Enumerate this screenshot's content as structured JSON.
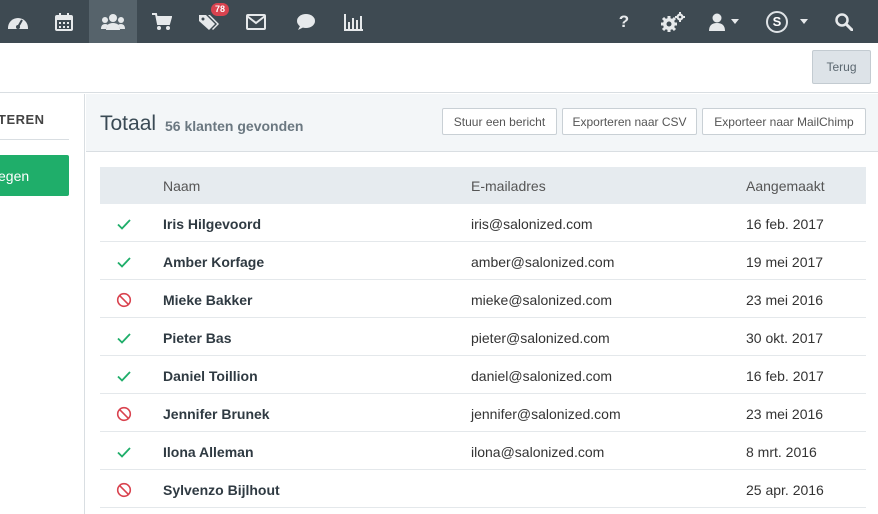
{
  "nav": {
    "icons": [
      "dashboard-icon",
      "calendar-icon",
      "users-icon",
      "cart-icon",
      "tags-icon",
      "envelope-icon",
      "chat-icon",
      "bar-chart-icon",
      "help-icon",
      "cogs-icon",
      "user-icon",
      "search-icon"
    ],
    "active": "users-icon",
    "badge_count": "78",
    "help_label": "?",
    "avatar_letter": "S",
    "colors": {
      "bar": "#3e4a52",
      "active": "#56636b",
      "badge": "#d9434f"
    }
  },
  "toolbar": {
    "back_label": "Terug"
  },
  "sidebar": {
    "filter_heading": "TEREN",
    "action_label": "egen",
    "accent_color": "#1fae6a"
  },
  "header": {
    "title": "Totaal",
    "count_text": "56 klanten gevonden",
    "buttons": [
      "Stuur een bericht",
      "Exporteren naar CSV",
      "Exporteer naar MailChimp"
    ]
  },
  "table": {
    "columns": [
      "Naam",
      "E-mailadres",
      "Aangemaakt"
    ],
    "rows": [
      {
        "status": "active",
        "name": "Iris Hilgevoord",
        "email": "iris@salonized.com",
        "created": "16 feb. 2017"
      },
      {
        "status": "active",
        "name": "Amber Korfage",
        "email": "amber@salonized.com",
        "created": "19 mei 2017"
      },
      {
        "status": "blocked",
        "name": "Mieke Bakker",
        "email": "mieke@salonized.com",
        "created": "23 mei 2016"
      },
      {
        "status": "active",
        "name": "Pieter Bas",
        "email": "pieter@salonized.com",
        "created": "30 okt. 2017"
      },
      {
        "status": "active",
        "name": "Daniel Toillion",
        "email": "daniel@salonized.com",
        "created": "16 feb. 2017"
      },
      {
        "status": "blocked",
        "name": "Jennifer Brunek",
        "email": "jennifer@salonized.com",
        "created": "23 mei 2016"
      },
      {
        "status": "active",
        "name": "Ilona Alleman",
        "email": "ilona@salonized.com",
        "created": "8 mrt. 2016"
      },
      {
        "status": "blocked",
        "name": "Sylvenzo Bijlhout",
        "email": "",
        "created": "25 apr. 2016"
      }
    ],
    "status_colors": {
      "active": "#1fae6a",
      "blocked": "#d9434f"
    }
  }
}
